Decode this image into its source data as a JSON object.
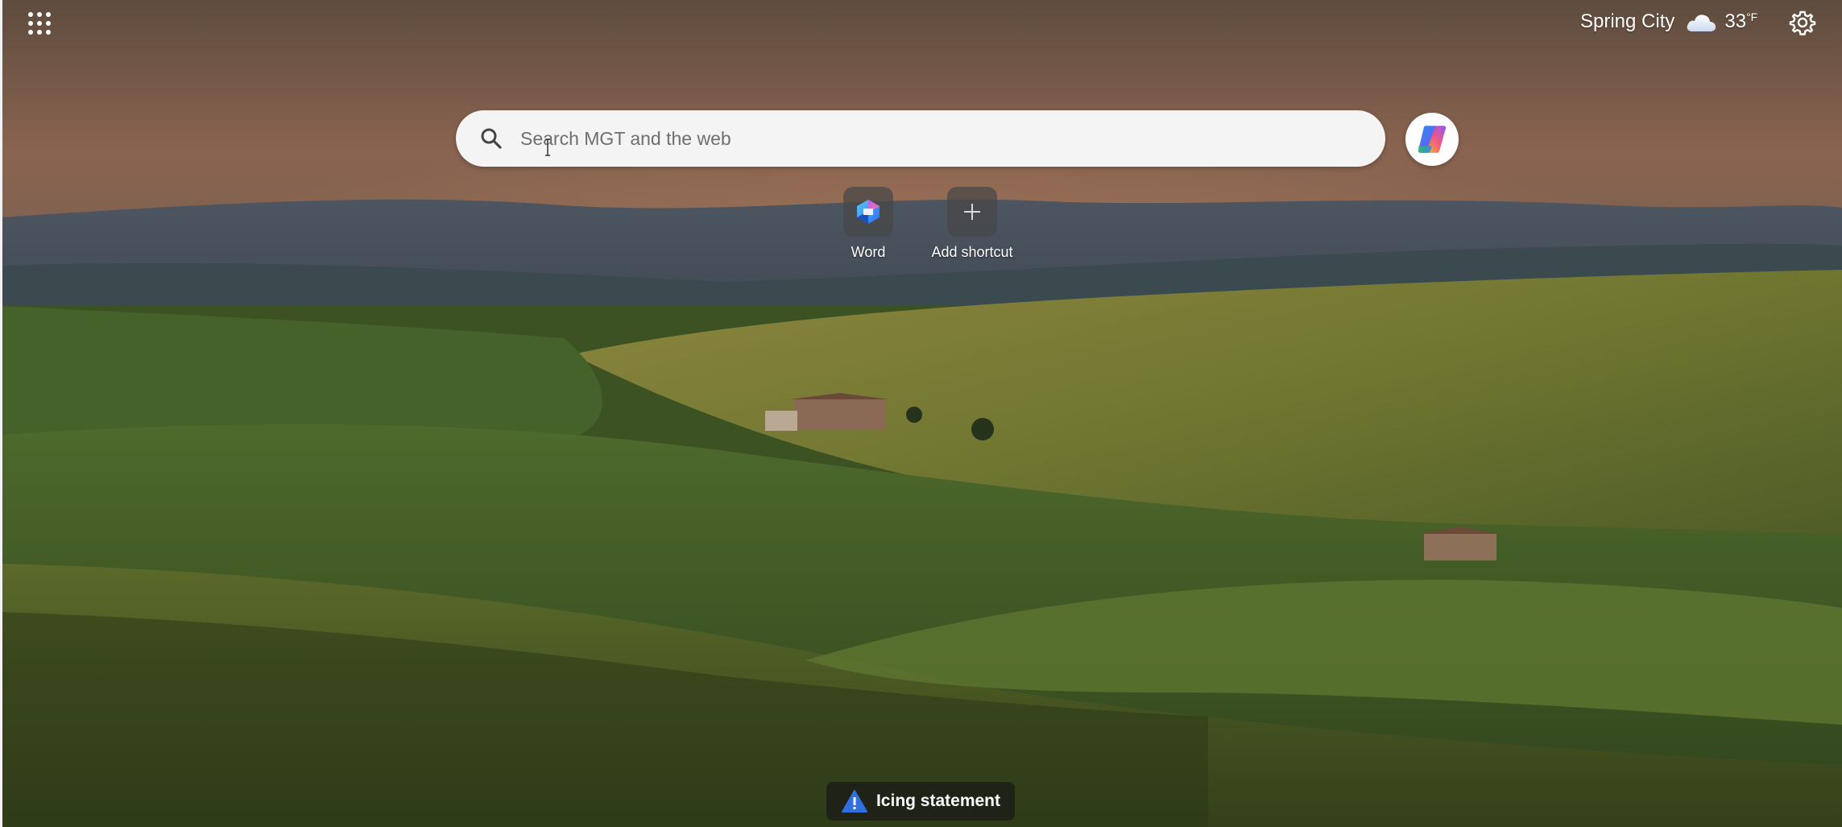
{
  "header": {
    "weather": {
      "city": "Spring City",
      "temperature": "33",
      "unit": "°F",
      "icon": "cloud-icon"
    },
    "icons": {
      "apps": "apps-grid-icon",
      "settings": "gear-icon"
    }
  },
  "search": {
    "placeholder": "Search MGT and the web",
    "value": "",
    "icon": "search-icon"
  },
  "copilot": {
    "icon": "copilot-icon"
  },
  "shortcuts": [
    {
      "label": "Word",
      "icon": "word-app-icon"
    },
    {
      "label": "Add shortcut",
      "icon": "plus-icon"
    }
  ],
  "notice": {
    "label": "Icing statement",
    "icon": "warning-icon",
    "color": "#2f6fe0"
  },
  "colors": {
    "search_bg": "#f4f4f4",
    "tile_bg": "#464646"
  }
}
